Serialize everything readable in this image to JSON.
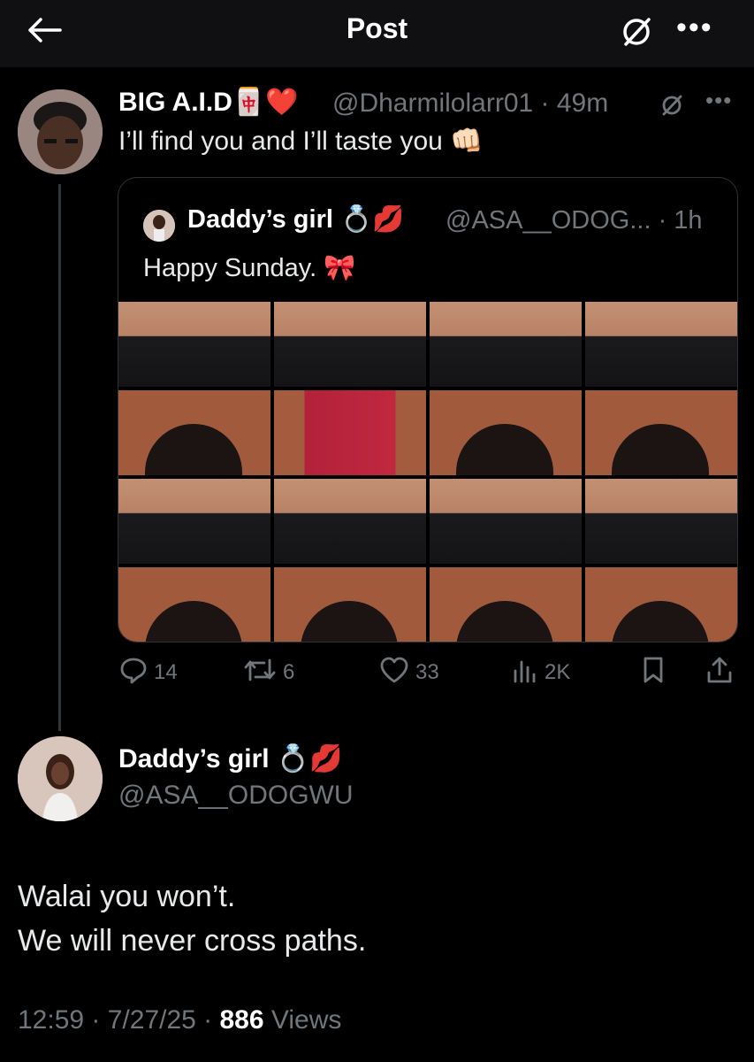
{
  "header": {
    "title": "Post"
  },
  "parent_post": {
    "name": "BIG A.I.D🀄❤️",
    "handle_time": "@Dharmilolarr01 · 49m",
    "text": "I’ll find you and I’ll taste you 👊🏻",
    "quoted_post": {
      "name": "Daddy’s girl 💍💋",
      "handle_time": "@ASA__ODOG... · 1h",
      "text": "Happy Sunday. 🎀"
    },
    "actions": {
      "replies": "14",
      "reposts": "6",
      "likes": "33",
      "views": "2K"
    }
  },
  "main_post": {
    "name": "Daddy’s girl 💍💋",
    "handle": "@ASA__ODOGWU",
    "text_line1": "Walai you won’t.",
    "text_line2": "We will never cross paths.",
    "timestamp": "12:59 · 7/27/25 · ",
    "views_count": "886",
    "views_label": " Views"
  },
  "icons": [
    "back-arrow-icon",
    "grok-icon",
    "more-icon",
    "reply-icon",
    "repost-icon",
    "like-icon",
    "views-icon",
    "bookmark-icon",
    "share-icon"
  ]
}
